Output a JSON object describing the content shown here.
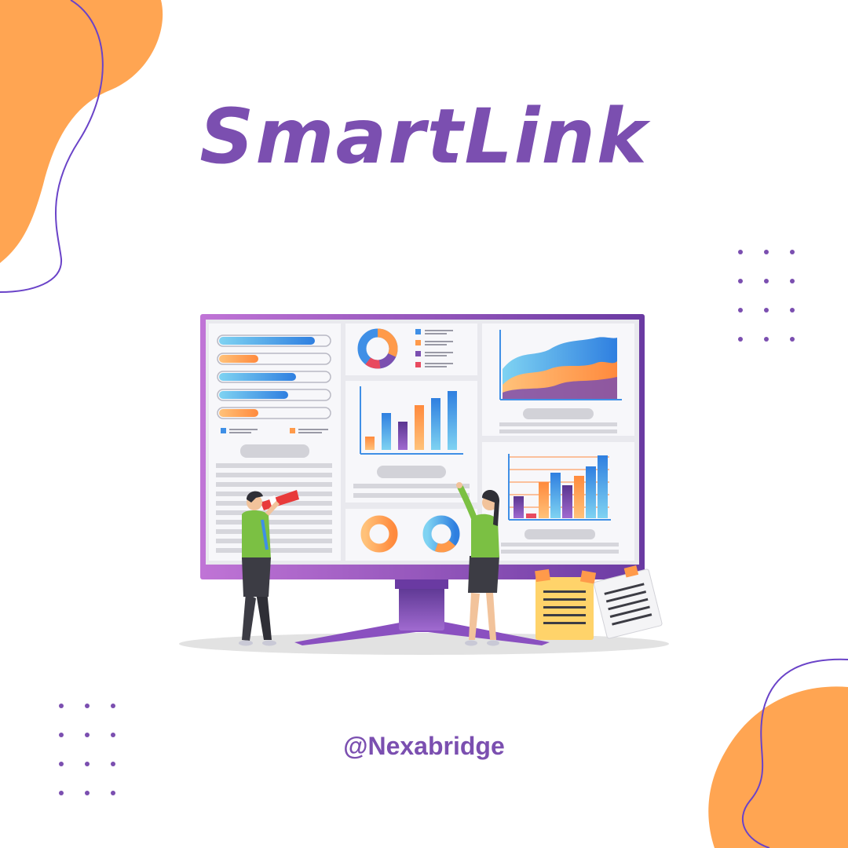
{
  "poster": {
    "title": "SmartLink",
    "handle": "@Nexabridge"
  },
  "colors": {
    "brand_purple": "#7b4fb0",
    "accent_orange": "#ffa552",
    "blue": "#3f8fe6",
    "background": "#ffffff"
  },
  "illustration": {
    "subject": "two people analysing a dashboard on a large monitor",
    "icons": [
      "monitor-icon",
      "bar-chart-icon",
      "area-chart-icon",
      "donut-chart-icon",
      "telescope-icon",
      "sticky-note-icon"
    ]
  }
}
